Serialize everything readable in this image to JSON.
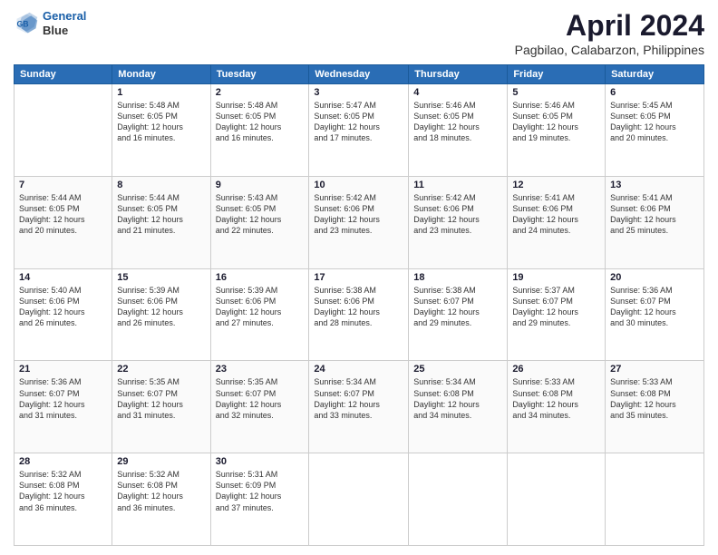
{
  "header": {
    "logo_line1": "General",
    "logo_line2": "Blue",
    "title": "April 2024",
    "subtitle": "Pagbilao, Calabarzon, Philippines"
  },
  "calendar": {
    "days": [
      "Sunday",
      "Monday",
      "Tuesday",
      "Wednesday",
      "Thursday",
      "Friday",
      "Saturday"
    ],
    "weeks": [
      [
        {
          "date": "",
          "info": ""
        },
        {
          "date": "1",
          "info": "Sunrise: 5:48 AM\nSunset: 6:05 PM\nDaylight: 12 hours\nand 16 minutes."
        },
        {
          "date": "2",
          "info": "Sunrise: 5:48 AM\nSunset: 6:05 PM\nDaylight: 12 hours\nand 16 minutes."
        },
        {
          "date": "3",
          "info": "Sunrise: 5:47 AM\nSunset: 6:05 PM\nDaylight: 12 hours\nand 17 minutes."
        },
        {
          "date": "4",
          "info": "Sunrise: 5:46 AM\nSunset: 6:05 PM\nDaylight: 12 hours\nand 18 minutes."
        },
        {
          "date": "5",
          "info": "Sunrise: 5:46 AM\nSunset: 6:05 PM\nDaylight: 12 hours\nand 19 minutes."
        },
        {
          "date": "6",
          "info": "Sunrise: 5:45 AM\nSunset: 6:05 PM\nDaylight: 12 hours\nand 20 minutes."
        }
      ],
      [
        {
          "date": "7",
          "info": "Sunrise: 5:44 AM\nSunset: 6:05 PM\nDaylight: 12 hours\nand 20 minutes."
        },
        {
          "date": "8",
          "info": "Sunrise: 5:44 AM\nSunset: 6:05 PM\nDaylight: 12 hours\nand 21 minutes."
        },
        {
          "date": "9",
          "info": "Sunrise: 5:43 AM\nSunset: 6:05 PM\nDaylight: 12 hours\nand 22 minutes."
        },
        {
          "date": "10",
          "info": "Sunrise: 5:42 AM\nSunset: 6:06 PM\nDaylight: 12 hours\nand 23 minutes."
        },
        {
          "date": "11",
          "info": "Sunrise: 5:42 AM\nSunset: 6:06 PM\nDaylight: 12 hours\nand 23 minutes."
        },
        {
          "date": "12",
          "info": "Sunrise: 5:41 AM\nSunset: 6:06 PM\nDaylight: 12 hours\nand 24 minutes."
        },
        {
          "date": "13",
          "info": "Sunrise: 5:41 AM\nSunset: 6:06 PM\nDaylight: 12 hours\nand 25 minutes."
        }
      ],
      [
        {
          "date": "14",
          "info": "Sunrise: 5:40 AM\nSunset: 6:06 PM\nDaylight: 12 hours\nand 26 minutes."
        },
        {
          "date": "15",
          "info": "Sunrise: 5:39 AM\nSunset: 6:06 PM\nDaylight: 12 hours\nand 26 minutes."
        },
        {
          "date": "16",
          "info": "Sunrise: 5:39 AM\nSunset: 6:06 PM\nDaylight: 12 hours\nand 27 minutes."
        },
        {
          "date": "17",
          "info": "Sunrise: 5:38 AM\nSunset: 6:06 PM\nDaylight: 12 hours\nand 28 minutes."
        },
        {
          "date": "18",
          "info": "Sunrise: 5:38 AM\nSunset: 6:07 PM\nDaylight: 12 hours\nand 29 minutes."
        },
        {
          "date": "19",
          "info": "Sunrise: 5:37 AM\nSunset: 6:07 PM\nDaylight: 12 hours\nand 29 minutes."
        },
        {
          "date": "20",
          "info": "Sunrise: 5:36 AM\nSunset: 6:07 PM\nDaylight: 12 hours\nand 30 minutes."
        }
      ],
      [
        {
          "date": "21",
          "info": "Sunrise: 5:36 AM\nSunset: 6:07 PM\nDaylight: 12 hours\nand 31 minutes."
        },
        {
          "date": "22",
          "info": "Sunrise: 5:35 AM\nSunset: 6:07 PM\nDaylight: 12 hours\nand 31 minutes."
        },
        {
          "date": "23",
          "info": "Sunrise: 5:35 AM\nSunset: 6:07 PM\nDaylight: 12 hours\nand 32 minutes."
        },
        {
          "date": "24",
          "info": "Sunrise: 5:34 AM\nSunset: 6:07 PM\nDaylight: 12 hours\nand 33 minutes."
        },
        {
          "date": "25",
          "info": "Sunrise: 5:34 AM\nSunset: 6:08 PM\nDaylight: 12 hours\nand 34 minutes."
        },
        {
          "date": "26",
          "info": "Sunrise: 5:33 AM\nSunset: 6:08 PM\nDaylight: 12 hours\nand 34 minutes."
        },
        {
          "date": "27",
          "info": "Sunrise: 5:33 AM\nSunset: 6:08 PM\nDaylight: 12 hours\nand 35 minutes."
        }
      ],
      [
        {
          "date": "28",
          "info": "Sunrise: 5:32 AM\nSunset: 6:08 PM\nDaylight: 12 hours\nand 36 minutes."
        },
        {
          "date": "29",
          "info": "Sunrise: 5:32 AM\nSunset: 6:08 PM\nDaylight: 12 hours\nand 36 minutes."
        },
        {
          "date": "30",
          "info": "Sunrise: 5:31 AM\nSunset: 6:09 PM\nDaylight: 12 hours\nand 37 minutes."
        },
        {
          "date": "",
          "info": ""
        },
        {
          "date": "",
          "info": ""
        },
        {
          "date": "",
          "info": ""
        },
        {
          "date": "",
          "info": ""
        }
      ]
    ]
  }
}
